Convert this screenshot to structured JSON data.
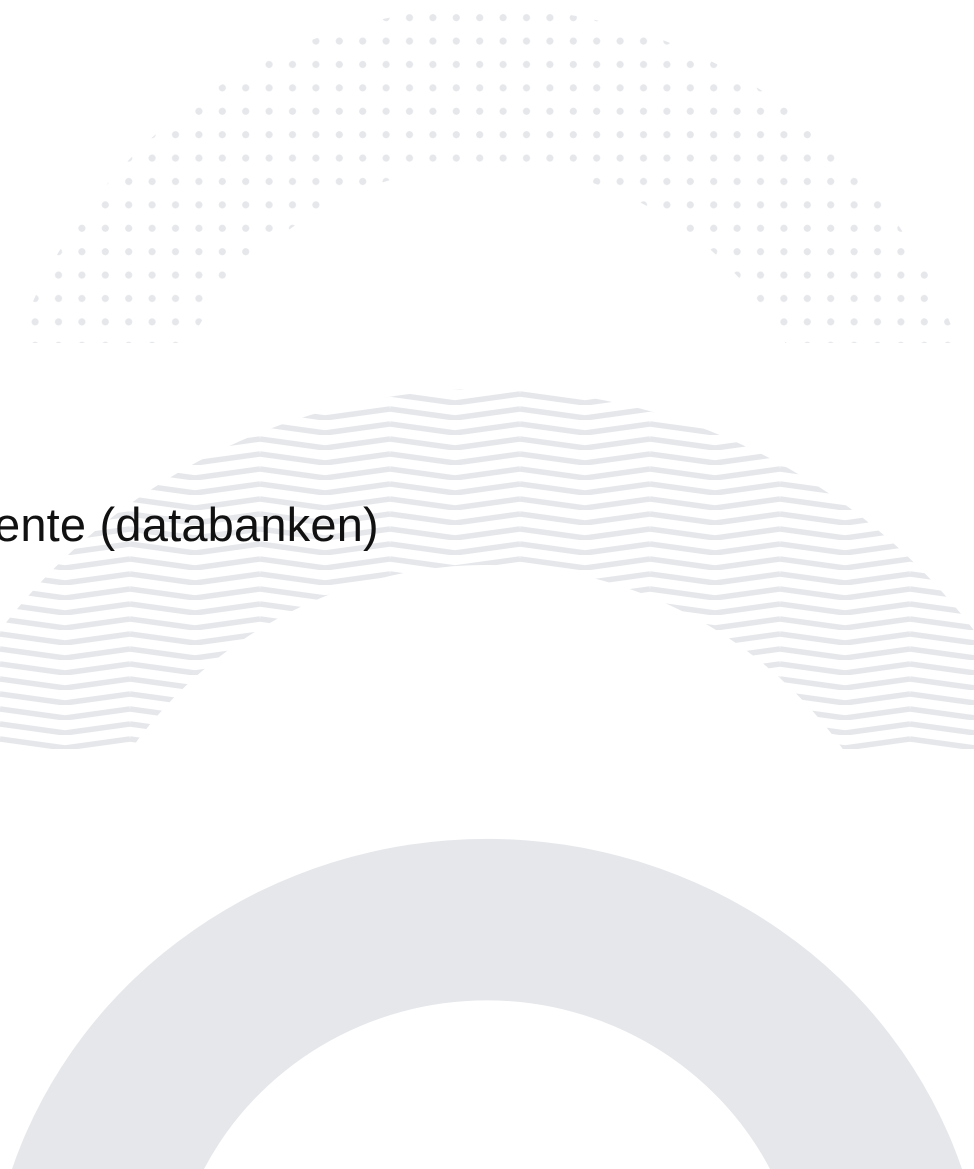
{
  "slide": {
    "heading": "ente (databanken)"
  },
  "decoration": {
    "pattern_color": "#e5e7eb",
    "background_color": "#ffffff",
    "shapes": [
      "dot-pattern-arch",
      "chevron-pattern-arch",
      "solid-ring-arch"
    ]
  }
}
